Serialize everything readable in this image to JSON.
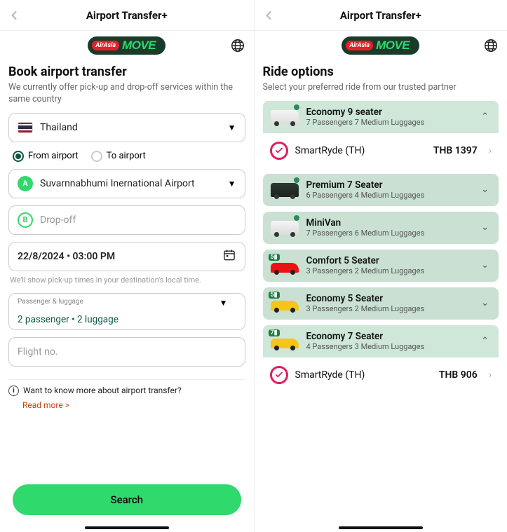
{
  "left": {
    "header": {
      "title": "Airport Transfer+"
    },
    "brand": {
      "airasia": "AirAsia",
      "move": "MOVE"
    },
    "page_title": "Book airport transfer",
    "page_sub": "We currently offer pick-up and drop-off services within the same country",
    "country": {
      "name": "Thailand"
    },
    "direction": {
      "from_label": "From airport",
      "to_label": "To airport",
      "selected": "from"
    },
    "pickup": {
      "badge": "A",
      "value": "Suvarnnabhumi Inernational Airport"
    },
    "dropoff": {
      "badge": "B",
      "placeholder": "Drop-off"
    },
    "datetime": {
      "value": "22/8/2024 • 03:00 PM"
    },
    "time_hint": "We'll show pick-up times in your destination's local time.",
    "pax": {
      "mini": "Passenger & luggage",
      "value": "2 passenger • 2 luggage"
    },
    "flight": {
      "placeholder": "Flight no."
    },
    "info_q": "Want to know more about airport transfer?",
    "readmore": "Read more >",
    "search_label": "Search"
  },
  "right": {
    "header": {
      "title": "Airport Transfer+"
    },
    "page_title": "Ride options",
    "page_sub": "Select your preferred ride from our trusted partner",
    "rides": [
      {
        "name": "Economy 9 seater",
        "sub": "7 Passengers 7 Medium Luggages",
        "vehicle": "van-white",
        "expanded": true,
        "provider": {
          "name": "SmartRyde (TH)",
          "price": "THB 1397"
        }
      },
      {
        "name": "Premium 7 Seater",
        "sub": "6 Passengers 4 Medium Luggages",
        "vehicle": "van-dark",
        "expanded": false
      },
      {
        "name": "MiniVan",
        "sub": "7 Passengers 6 Medium Luggages",
        "vehicle": "van-white",
        "expanded": false
      },
      {
        "name": "Comfort 5 Seater",
        "sub": "3 Passengers 2 Medium Luggages",
        "vehicle": "car-red",
        "cap": "5",
        "expanded": false
      },
      {
        "name": "Economy 5 Seater",
        "sub": "3 Passengers 2 Medium Luggages",
        "vehicle": "car-yellow",
        "cap": "5",
        "expanded": false
      },
      {
        "name": "Economy 7 Seater",
        "sub": "4 Passengers 3 Medium Luggages",
        "vehicle": "car-yellow",
        "cap": "7",
        "expanded": true,
        "provider": {
          "name": "SmartRyde (TH)",
          "price": "THB 906"
        }
      }
    ]
  }
}
